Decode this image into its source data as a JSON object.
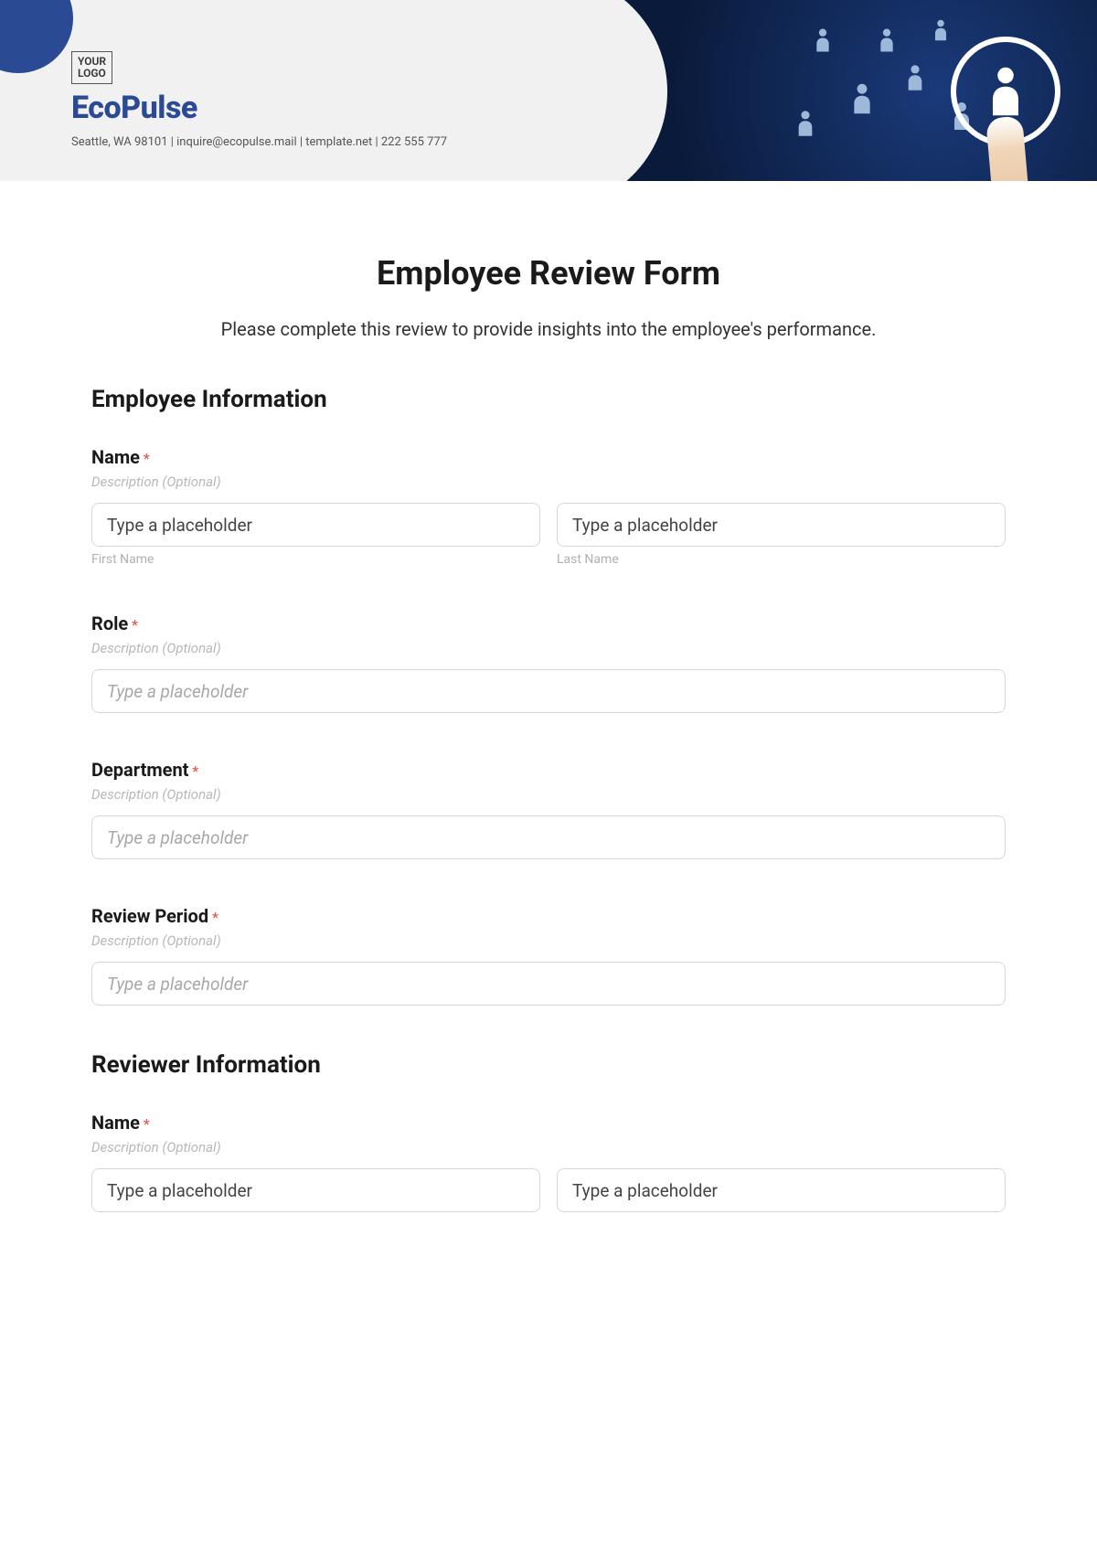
{
  "header": {
    "logo_text_line1": "YOUR",
    "logo_text_line2": "LOGO",
    "company_name": "EcoPulse",
    "company_info": "Seattle, WA 98101 | inquire@ecopulse.mail | template.net | 222 555 777"
  },
  "form": {
    "title": "Employee Review Form",
    "intro": "Please complete this review to provide insights into the employee's performance."
  },
  "sections": {
    "employee_info": {
      "heading": "Employee Information",
      "name": {
        "label": "Name",
        "required": "*",
        "description": "Description (Optional)",
        "first_placeholder": "Type a placeholder",
        "first_sublabel": "First Name",
        "last_placeholder": "Type a placeholder",
        "last_sublabel": "Last Name"
      },
      "role": {
        "label": "Role",
        "required": "*",
        "description": "Description (Optional)",
        "placeholder": "Type a placeholder"
      },
      "department": {
        "label": "Department",
        "required": "*",
        "description": "Description (Optional)",
        "placeholder": "Type a placeholder"
      },
      "review_period": {
        "label": "Review Period",
        "required": "*",
        "description": "Description (Optional)",
        "placeholder": "Type a placeholder"
      }
    },
    "reviewer_info": {
      "heading": "Reviewer Information",
      "name": {
        "label": "Name",
        "required": "*",
        "description": "Description (Optional)",
        "first_placeholder": "Type a placeholder",
        "last_placeholder": "Type a placeholder"
      }
    }
  }
}
